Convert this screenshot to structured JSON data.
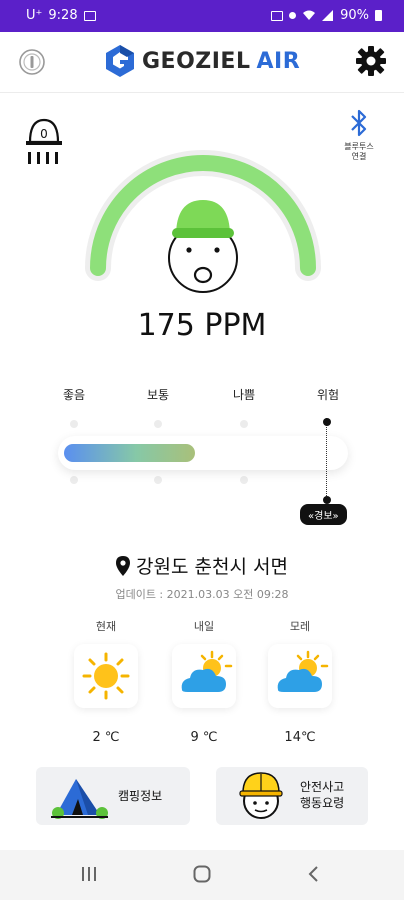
{
  "status_bar": {
    "carrier": "U⁺",
    "time": "9:28",
    "battery": "90%"
  },
  "header": {
    "brand_main": "GEOZIEL",
    "brand_accent": "AIR",
    "brand_color": "#2c6bd6"
  },
  "alarm": {
    "value": "0"
  },
  "bluetooth": {
    "label": "블루투스\n연결",
    "color": "#2c6bd6"
  },
  "gauge": {
    "ppm_text": "175 PPM",
    "arc_color": "#8ee07a"
  },
  "levels": {
    "labels": [
      "좋음",
      "보통",
      "나쁨",
      "위험"
    ],
    "bar_fill_fraction": 0.47,
    "warning_badge": "«경보»"
  },
  "location": {
    "name": "강원도 춘천시 서면",
    "updated": "업데이트 : 2021.03.03 오전 09:28"
  },
  "weather": [
    {
      "label": "현재",
      "icon": "sun-icon",
      "temp": "2 ℃"
    },
    {
      "label": "내일",
      "icon": "partly-cloudy-icon",
      "temp": "9 ℃"
    },
    {
      "label": "모레",
      "icon": "partly-cloudy-icon",
      "temp": "14℃"
    }
  ],
  "buttons": {
    "camping": "캠핑정보",
    "safety_line1": "안전사고",
    "safety_line2": "행동요령"
  },
  "colors": {
    "status_bar": "#5b20c9",
    "accent": "#2c6bd6"
  }
}
